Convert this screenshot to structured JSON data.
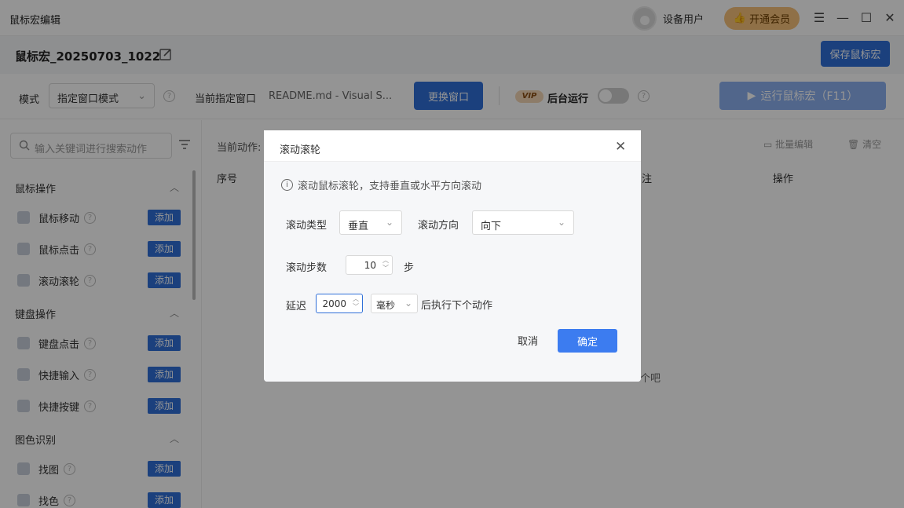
{
  "app": {
    "title": "鼠标宏编辑"
  },
  "titlebar": {
    "user_label": "设备用户",
    "vip_label": "开通会员"
  },
  "macro": {
    "name": "鼠标宏_20250703_1022",
    "save_label": "保存鼠标宏"
  },
  "modebar": {
    "mode_label": "模式",
    "mode_value": "指定窗口模式",
    "current_window_label": "当前指定窗口",
    "current_window_value": "README.md - Visual S...",
    "swap_window_label": "更换窗口",
    "vip_tag": "VIP",
    "bg_run_label": "后台运行",
    "run_label": "运行鼠标宏（F11）"
  },
  "sidebar": {
    "search_placeholder": "输入关键词进行搜索动作",
    "sections": [
      {
        "title": "鼠标操作",
        "items": [
          {
            "label": "鼠标移动",
            "add": "添加"
          },
          {
            "label": "鼠标点击",
            "add": "添加"
          },
          {
            "label": "滚动滚轮",
            "add": "添加"
          }
        ]
      },
      {
        "title": "键盘操作",
        "items": [
          {
            "label": "键盘点击",
            "add": "添加"
          },
          {
            "label": "快捷输入",
            "add": "添加"
          },
          {
            "label": "快捷按键",
            "add": "添加"
          }
        ]
      },
      {
        "title": "图色识别",
        "items": [
          {
            "label": "找图",
            "add": "添加"
          },
          {
            "label": "找色",
            "add": "添加"
          }
        ]
      }
    ]
  },
  "main": {
    "current_actions": "当前动作:",
    "batch_edit": "批量编辑",
    "clear": "清空",
    "columns": [
      "序号",
      "注",
      "操作"
    ],
    "empty_hint": "个吧"
  },
  "dialog": {
    "title": "滚动滚轮",
    "info": "滚动鼠标滚轮，支持垂直或水平方向滚动",
    "scroll_type_label": "滚动类型",
    "scroll_type_value": "垂直",
    "scroll_dir_label": "滚动方向",
    "scroll_dir_value": "向下",
    "steps_label": "滚动步数",
    "steps_value": "10",
    "steps_unit": "步",
    "delay_label": "延迟",
    "delay_value": "2000",
    "delay_unit_value": "毫秒",
    "delay_suffix": "后执行下个动作",
    "cancel": "取消",
    "ok": "确定"
  }
}
